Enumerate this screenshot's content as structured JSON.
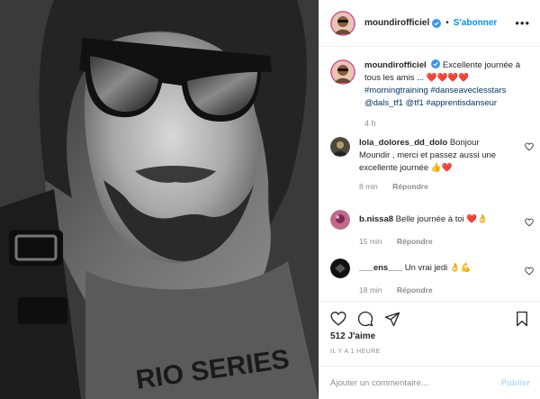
{
  "post": {
    "username": "moundirofficiel",
    "follow_label": "S'abonner",
    "separator": "•",
    "more": "•••"
  },
  "caption": {
    "username": "moundirofficiel",
    "text": "Excellente journée à tous les amis ...",
    "emoji": "❤️❤️❤️❤️",
    "hashtags": "#morningtraining #danseaveclesstars",
    "mentions": "@dals_tf1 @tf1 #apprentisdanseur",
    "time": "4 h"
  },
  "comments": [
    {
      "username": "lola_dolores_dd_dolo",
      "text": "Bonjour Moundir , merci et passez aussi une excellente journée 👍❤️",
      "time": "8 min",
      "reply": "Répondre"
    },
    {
      "username": "b.nissa8",
      "text": "Belle journée à toi ❤️👌",
      "time": "15 min",
      "reply": "Répondre"
    },
    {
      "username": "___ens___",
      "text": "Un vrai jedi 👌💪",
      "time": "18 min",
      "reply": "Répondre"
    }
  ],
  "stats": {
    "likes": "512 J'aime",
    "posted": "IL Y A 1 HEURE"
  },
  "add_comment": {
    "placeholder": "Ajouter un commentaire...",
    "post_label": "Publier"
  },
  "colors": {
    "accent": "#0095f6",
    "link": "#00376b",
    "muted": "#8e8e8e",
    "post_disabled": "#b2dffc",
    "verified": "#3897f0"
  }
}
